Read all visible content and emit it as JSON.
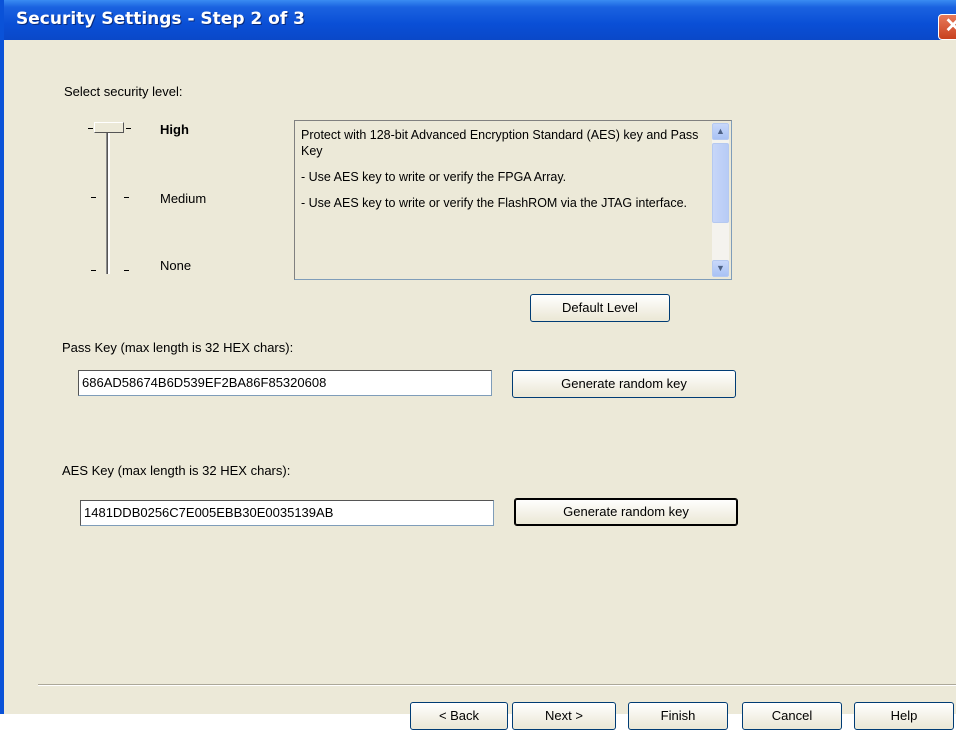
{
  "window": {
    "title": "Security Settings - Step 2 of 3",
    "close_glyph": "✕"
  },
  "security": {
    "heading": "Select security level:",
    "levels": [
      "High",
      "Medium",
      "None"
    ],
    "selected": "High",
    "description": [
      "Protect with 128-bit Advanced Encryption Standard (AES) key and Pass Key",
      "- Use AES key to write or verify the FPGA Array.",
      "- Use AES key to write or verify the FlashROM via the JTAG interface."
    ],
    "default_button": "Default Level"
  },
  "pass_key": {
    "label": "Pass Key (max length is 32 HEX chars):",
    "value": "686AD58674B6D539EF2BA86F85320608",
    "generate_button": "Generate random key"
  },
  "aes_key": {
    "label": "AES Key (max length is 32 HEX chars):",
    "value": "1481DDB0256C7E005EBB30E0035139AB",
    "generate_button": "Generate random key"
  },
  "footer": {
    "back": "< Back",
    "next": "Next >",
    "finish": "Finish",
    "cancel": "Cancel",
    "help": "Help"
  },
  "icons": {
    "scroll_up": "up-arrow-icon",
    "scroll_down": "down-arrow-icon",
    "close": "close-icon"
  }
}
